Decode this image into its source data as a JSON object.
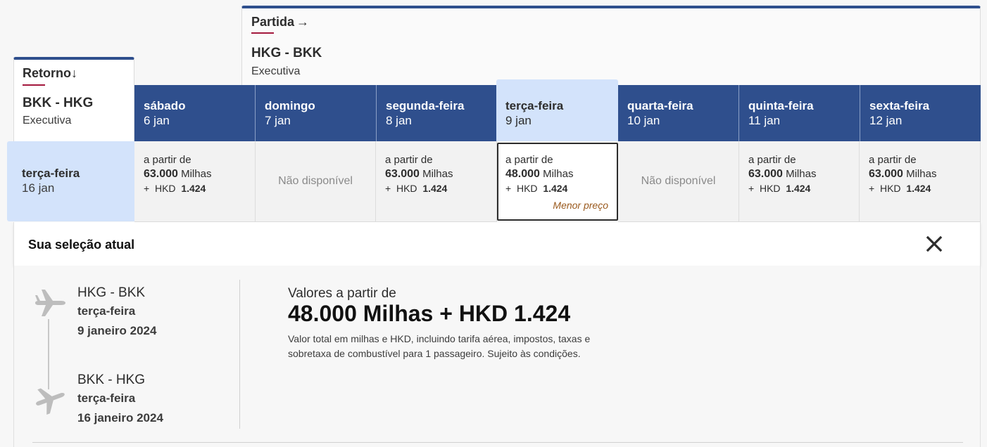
{
  "partida": {
    "label": "Partida",
    "arrow": "→",
    "route": "HKG - BKK",
    "cabin": "Executiva"
  },
  "retorno": {
    "label": "Retorno",
    "arrow": "↓",
    "route": "BKK - HKG",
    "cabin": "Executiva"
  },
  "columns": [
    {
      "day": "sábado",
      "date": "6 jan"
    },
    {
      "day": "domingo",
      "date": "7 jan"
    },
    {
      "day": "segunda-feira",
      "date": "8 jan"
    },
    {
      "day": "terça-feira",
      "date": "9 jan",
      "selected": true
    },
    {
      "day": "quarta-feira",
      "date": "10 jan"
    },
    {
      "day": "quinta-feira",
      "date": "11 jan"
    },
    {
      "day": "sexta-feira",
      "date": "12 jan"
    }
  ],
  "row": {
    "day": "terça-feira",
    "date": "16 jan"
  },
  "cells": [
    {
      "from": "a partir de",
      "miles": "63.000",
      "miles_unit": "Milhas",
      "plus": "+",
      "currency": "HKD",
      "cash": "1.424"
    },
    {
      "unavailable": "Não disponível"
    },
    {
      "from": "a partir de",
      "miles": "63.000",
      "miles_unit": "Milhas",
      "plus": "+",
      "currency": "HKD",
      "cash": "1.424"
    },
    {
      "from": "a partir de",
      "miles": "48.000",
      "miles_unit": "Milhas",
      "plus": "+",
      "currency": "HKD",
      "cash": "1.424",
      "best_label": "Menor preço"
    },
    {
      "unavailable": "Não disponível"
    },
    {
      "from": "a partir de",
      "miles": "63.000",
      "miles_unit": "Milhas",
      "plus": "+",
      "currency": "HKD",
      "cash": "1.424"
    },
    {
      "from": "a partir de",
      "miles": "63.000",
      "miles_unit": "Milhas",
      "plus": "+",
      "currency": "HKD",
      "cash": "1.424"
    }
  ],
  "summary": {
    "title": "Sua seleção atual",
    "close_icon": "close-icon",
    "outbound": {
      "route": "HKG - BKK",
      "day": "terça-feira",
      "date": "9 janeiro 2024"
    },
    "inbound": {
      "route": "BKK - HKG",
      "day": "terça-feira",
      "date": "16 janeiro 2024"
    },
    "price_from": "Valores a partir de",
    "price_total": "48.000 Milhas + HKD 1.424",
    "price_note": "Valor total em milhas e HKD, incluindo tarifa aérea, impostos, taxas e sobretaxa de combustível para 1 passageiro. Sujeito às condições."
  },
  "colors": {
    "header_blue": "#2f4f8d",
    "selected_blue": "#d3e3fb",
    "accent_red": "#a3183d",
    "best_price_brown": "#9a5a1e"
  }
}
